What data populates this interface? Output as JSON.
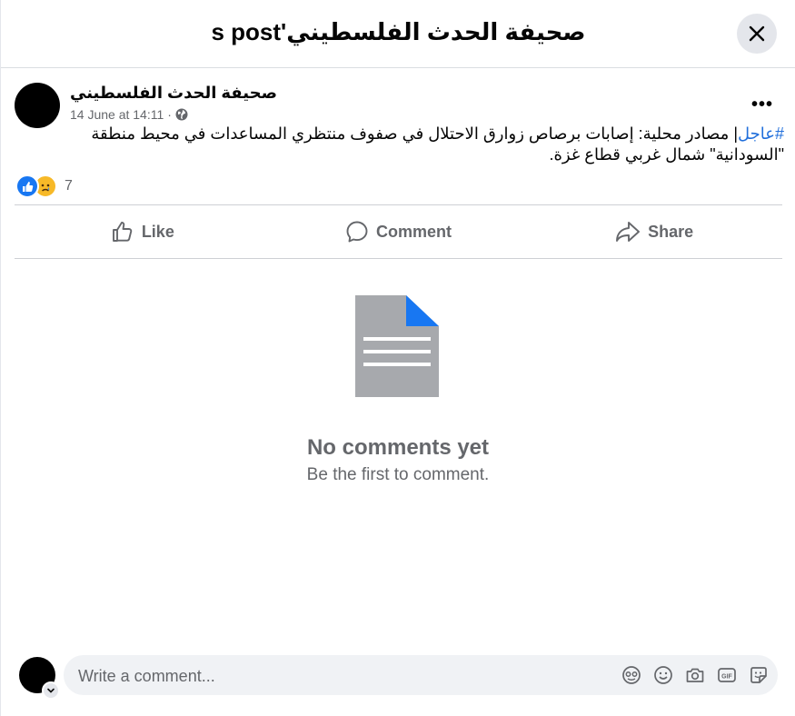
{
  "header": {
    "title": "صحيفة الحدث الفلسطيني's post"
  },
  "post": {
    "page_name": "صحيفة الحدث الفلسطيني",
    "timestamp": "14 June at 14:11",
    "separator": "·",
    "more_label": "•••",
    "hashtag": "#عاجل",
    "text": "| مصادر محلية: إصابات برصاص زوارق الاحتلال في صفوف منتظري المساعدات في محيط منطقة \"السودانية\" شمال غربي قطاع غزة.",
    "reaction_count": "7"
  },
  "actions": {
    "like": "Like",
    "comment": "Comment",
    "share": "Share"
  },
  "empty_state": {
    "title": "No comments yet",
    "subtitle": "Be the first to comment."
  },
  "composer": {
    "placeholder": "Write a comment..."
  },
  "icons": {
    "close": "close-icon",
    "globe": "globe-icon",
    "like": "thumbs-up-icon",
    "comment": "speech-bubble-icon",
    "share": "share-arrow-icon",
    "document": "document-icon",
    "avatar_sticker": "avatar-sticker-icon",
    "emoji": "emoji-icon",
    "camera": "camera-icon",
    "gif": "gif-icon",
    "sticker": "sticker-icon"
  },
  "colors": {
    "accent": "#1877f2",
    "hashtag": "#216fdb",
    "secondary_text": "#65676b",
    "sad_reaction": "#f7b928"
  }
}
